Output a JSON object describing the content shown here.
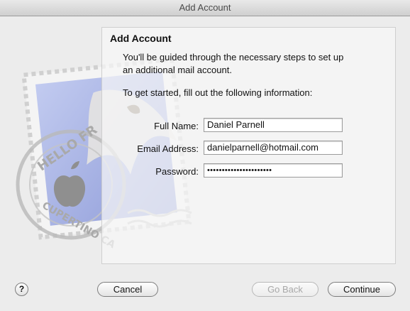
{
  "window": {
    "title": "Add Account"
  },
  "panel": {
    "heading": "Add Account",
    "intro_line1": "You'll be guided through the necessary steps to set up",
    "intro_line2": "an additional mail account.",
    "intro_prompt": "To get started, fill out the following information:"
  },
  "artwork": {
    "stamp_text_top": "HELLO FR",
    "stamp_text_bottom": "CUPERTINO CA"
  },
  "form": {
    "full_name_label": "Full Name:",
    "full_name_value": "Daniel Parnell",
    "email_label": "Email Address:",
    "email_value": "danielparnell@hotmail.com",
    "password_label": "Password:",
    "password_value": "••••••••••••••••••••••"
  },
  "buttons": {
    "help": "?",
    "cancel": "Cancel",
    "go_back": "Go Back",
    "continue": "Continue"
  },
  "colors": {
    "stamp_blue": "#aab5e6",
    "panel_bg": "#f6f6f6",
    "window_bg": "#ececec"
  }
}
